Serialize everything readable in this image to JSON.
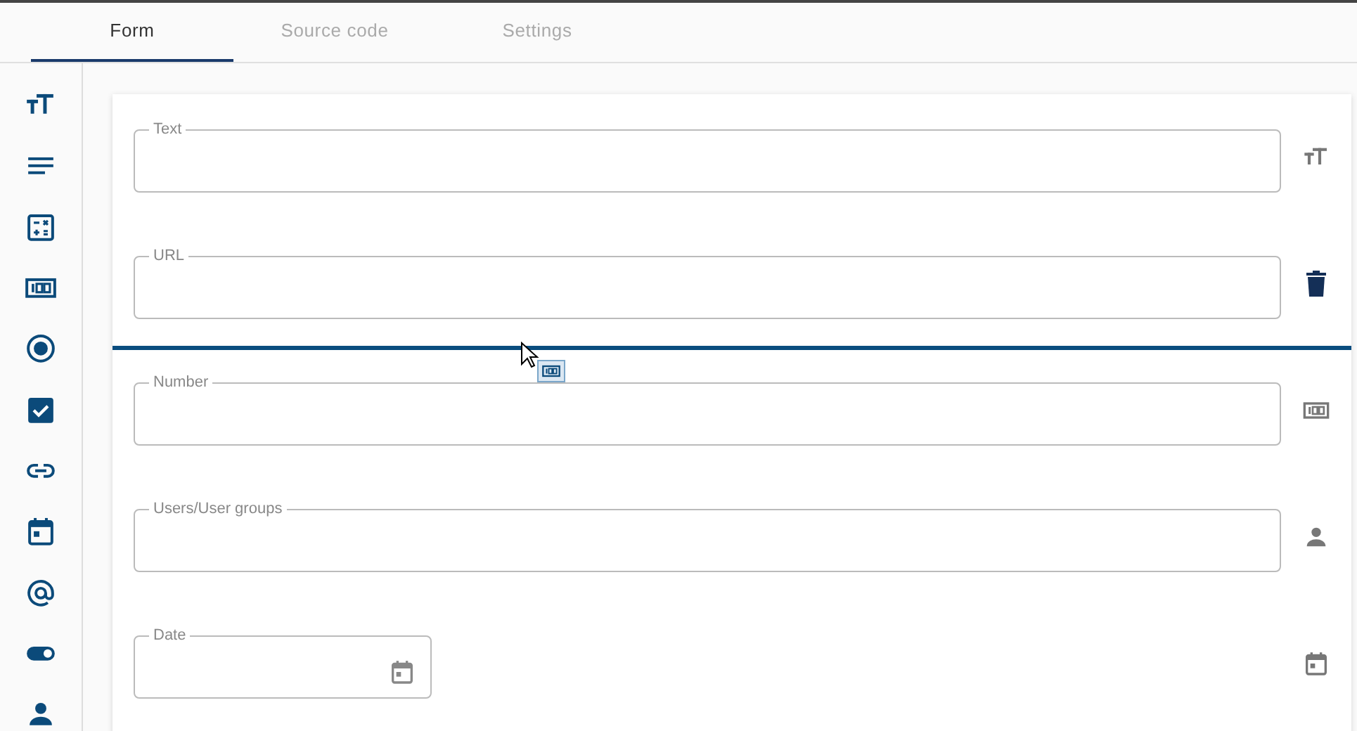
{
  "tabs": [
    {
      "label": "Form",
      "selected": true
    },
    {
      "label": "Source code",
      "selected": false
    },
    {
      "label": "Settings",
      "selected": false
    }
  ],
  "palette": [
    {
      "kind": "text"
    },
    {
      "kind": "textarea"
    },
    {
      "kind": "calculation"
    },
    {
      "kind": "number"
    },
    {
      "kind": "radio"
    },
    {
      "kind": "checkbox"
    },
    {
      "kind": "link"
    },
    {
      "kind": "date"
    },
    {
      "kind": "email"
    },
    {
      "kind": "toggle"
    },
    {
      "kind": "user"
    }
  ],
  "fields": [
    {
      "label": "Text",
      "kind": "text",
      "hovered": false,
      "drop_after": false
    },
    {
      "label": "URL",
      "kind": "link",
      "hovered": true,
      "drop_after": true
    },
    {
      "label": "Number",
      "kind": "number",
      "hovered": false,
      "drop_after": false
    },
    {
      "label": "Users/User groups",
      "kind": "user",
      "hovered": false,
      "drop_after": false
    },
    {
      "label": "Date",
      "kind": "date",
      "hovered": false,
      "drop_after": false
    }
  ],
  "dragging": {
    "kind": "number"
  }
}
